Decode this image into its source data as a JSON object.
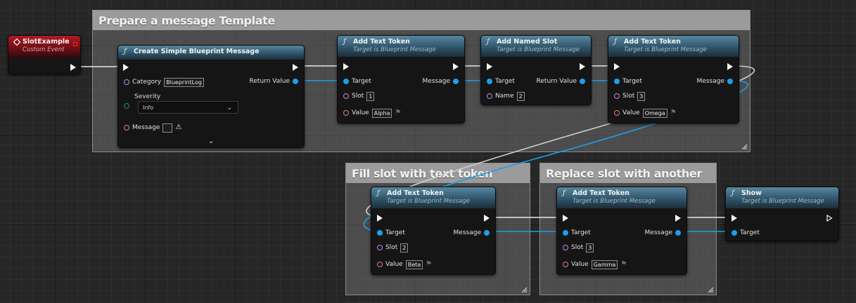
{
  "comments": {
    "prepare": "Prepare a message Template",
    "fill": "Fill slot with text token",
    "replace": "Replace slot with another"
  },
  "event": {
    "title": "SlotExample",
    "subtitle": "Custom Event"
  },
  "create": {
    "title": "Create Simple Blueprint Message",
    "category_label": "Category",
    "category_value": "BlueprintLog",
    "return_label": "Return Value",
    "severity_label": "Severity",
    "severity_value": "Info",
    "message_label": "Message"
  },
  "labels": {
    "target_subtitle": "Target is Blueprint Message",
    "target": "Target",
    "message": "Message",
    "slot": "Slot",
    "value": "Value",
    "name": "Name",
    "return_value": "Return Value"
  },
  "add1": {
    "title": "Add Text Token",
    "slot": "1",
    "value": "Alpha"
  },
  "named": {
    "title": "Add Named Slot",
    "name": "2"
  },
  "add2": {
    "title": "Add Text Token",
    "slot": "3",
    "value": "Omega"
  },
  "add3": {
    "title": "Add Text Token",
    "slot": "2",
    "value": "Beta"
  },
  "add4": {
    "title": "Add Text Token",
    "slot": "3",
    "value": "Gamma"
  },
  "show": {
    "title": "Show"
  },
  "colors": {
    "exec_wire": "#e8e8e8",
    "object_wire": "#1aa0e8",
    "event_header": "#b01a24",
    "function_header": "#4a7a94",
    "comment_title": "#9b9b9b"
  },
  "icons": {
    "function": "function-f-icon",
    "event": "event-diamond-icon",
    "warning": "warning-triangle-icon",
    "flag": "localization-flag-icon",
    "expand": "chevron-down-icon"
  }
}
